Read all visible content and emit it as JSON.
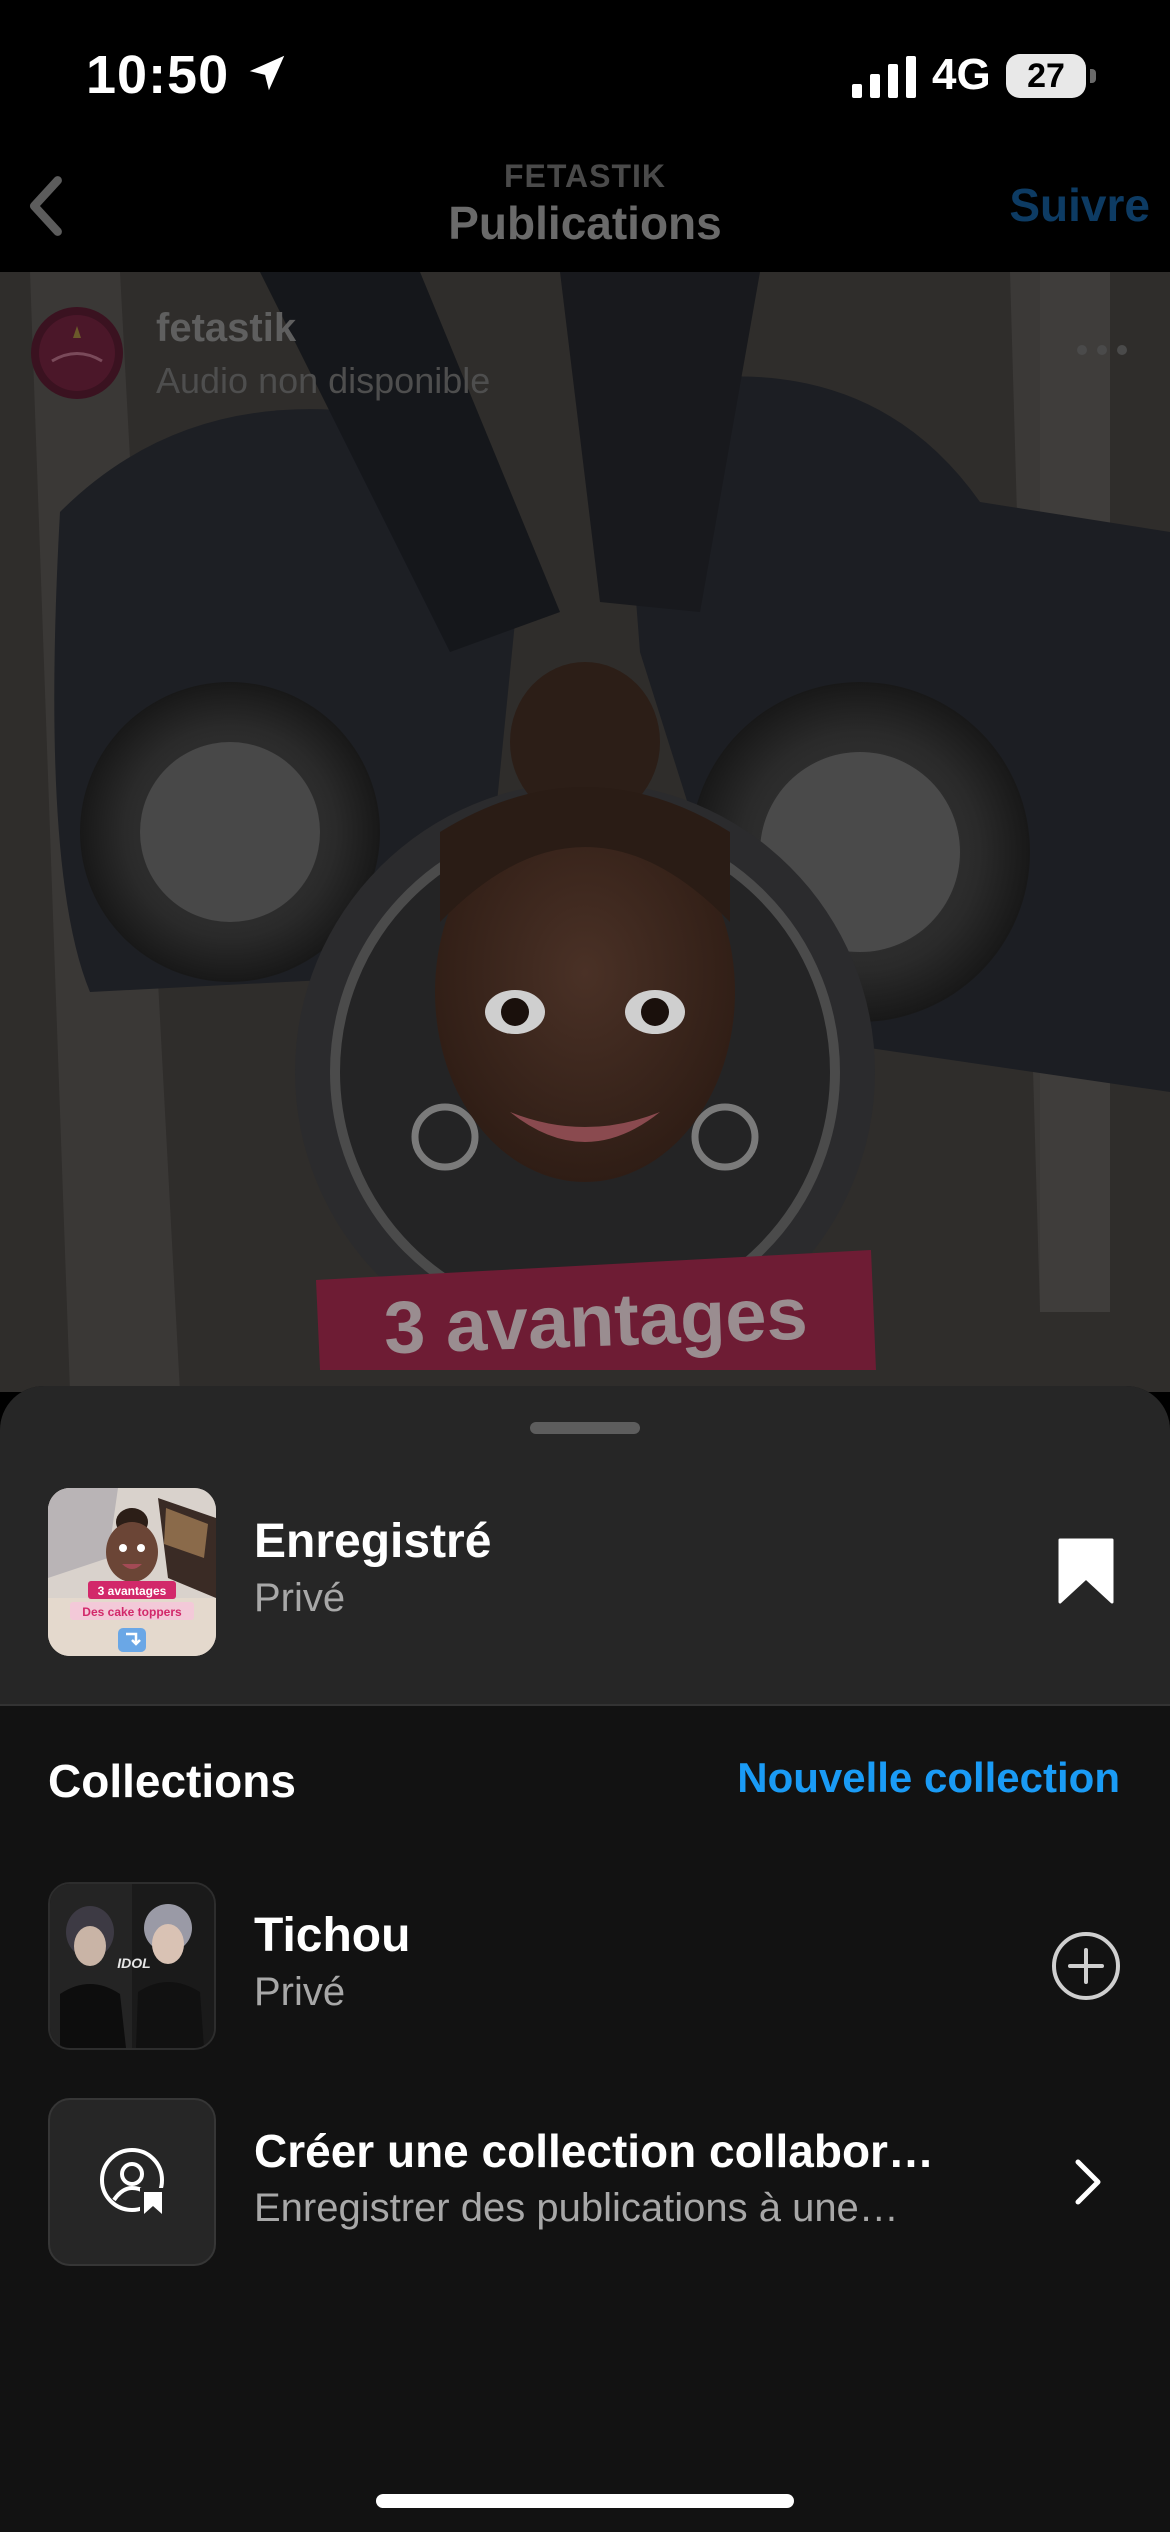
{
  "status_bar": {
    "time": "10:50",
    "network": "4G",
    "battery": "27",
    "icons": [
      "location-arrow-icon",
      "signal-bars-icon",
      "battery-icon"
    ]
  },
  "header": {
    "account_caption": "FETASTIK",
    "title": "Publications",
    "follow_label": "Suivre",
    "back_icon": "chevron-left-icon"
  },
  "post": {
    "username": "fetastik",
    "audio": "Audio non disponible",
    "more_icon": "more-horizontal-icon",
    "banner_text": "3 avantages"
  },
  "sheet": {
    "saved": {
      "title": "Enregistré",
      "subtitle": "Privé",
      "icon": "bookmark-filled-icon",
      "thumb_texts": [
        "3 avantages",
        "Des cake toppers"
      ]
    },
    "collections_heading": "Collections",
    "new_collection_label": "Nouvelle collection",
    "items": [
      {
        "title": "Tichou",
        "subtitle": "Privé",
        "action_icon": "plus-circle-icon",
        "thumb_text": "IDOL"
      },
      {
        "title": "Créer une collection collabor…",
        "subtitle": "Enregistrer des publications à une…",
        "action_icon": "chevron-right-icon",
        "thumb_icon": "collab-person-bookmark-icon"
      }
    ]
  },
  "colors": {
    "accent_link": "#1a9bf5",
    "sheet_top_bg": "#262626",
    "sheet_bg": "#121212"
  }
}
